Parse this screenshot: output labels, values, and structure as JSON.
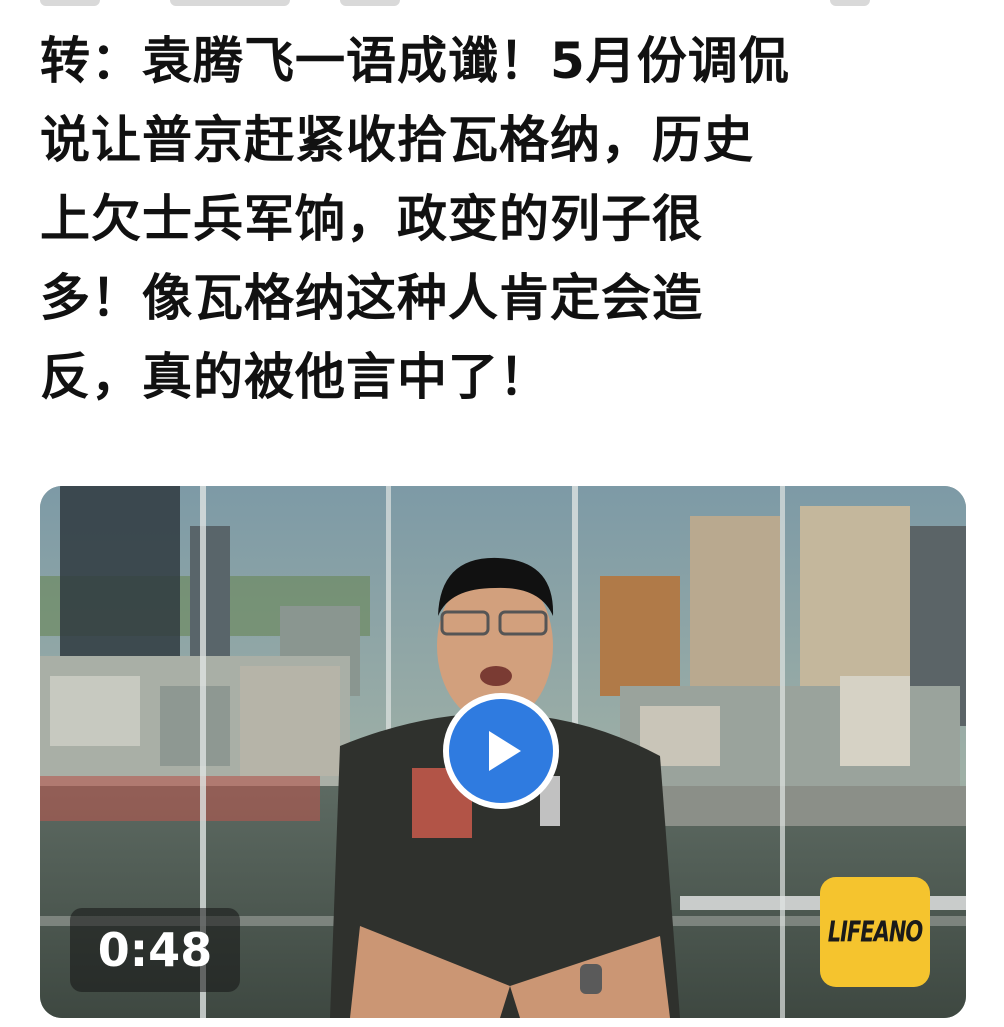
{
  "post": {
    "lines": [
      "转：袁腾飞一语成谶！5月份调侃",
      "说让普京赶紧收拾瓦格纳，历史",
      "上欠士兵军饷，政变的列子很",
      "多！像瓦格纳这种人肯定会造",
      "反，真的被他言中了！"
    ]
  },
  "video": {
    "duration": "0:48",
    "brand": "LIFEANO",
    "play_icon": "play-icon",
    "colors": {
      "play_accent": "#2f7be0",
      "brand_background": "#f5c42e"
    }
  }
}
